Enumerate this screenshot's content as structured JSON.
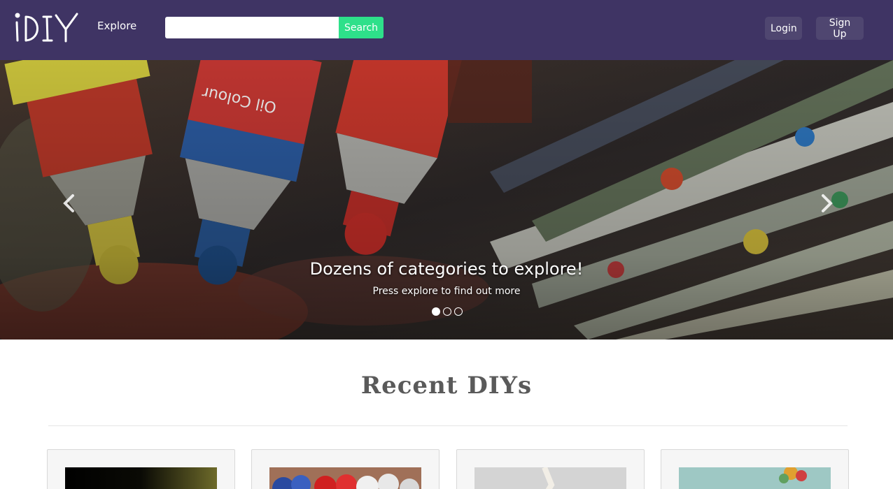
{
  "navbar": {
    "brand": "iDIY",
    "explore_label": "Explore",
    "search_placeholder": "",
    "search_value": "",
    "search_button_label": "Search",
    "login_label": "Login",
    "signup_label": "Sign Up",
    "colors": {
      "background": "#3f3464",
      "search_button": "#2ee08a",
      "nav_button": "#4f4670"
    }
  },
  "carousel": {
    "title": "Dozens of categories to explore!",
    "subtitle": "Press explore to find out more",
    "slide_count": 3,
    "active_slide": 1,
    "prev_icon": "chevron-left-icon",
    "next_icon": "chevron-right-icon"
  },
  "recent": {
    "heading": "Recent DIYs",
    "cards": [
      {
        "image": "dark-gradient-photo"
      },
      {
        "image": "flowers-photo"
      },
      {
        "image": "light-craft-photo"
      },
      {
        "image": "teal-craft-photo"
      }
    ]
  }
}
